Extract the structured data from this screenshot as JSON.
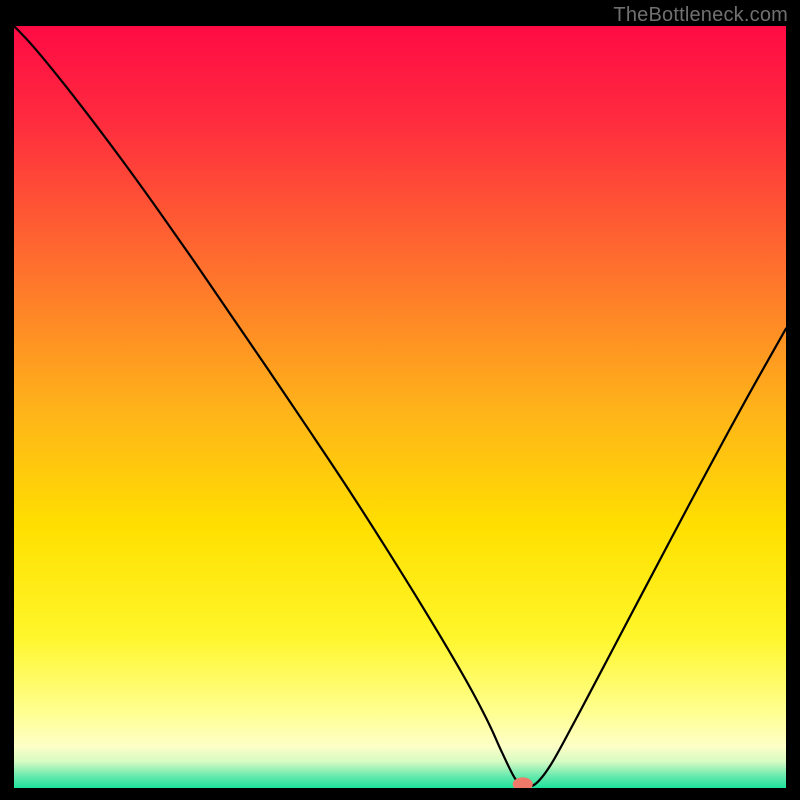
{
  "watermark": "TheBottleneck.com",
  "chart_data": {
    "type": "line",
    "title": "",
    "xlabel": "",
    "ylabel": "",
    "xlim": [
      0,
      100
    ],
    "ylim": [
      0,
      100
    ],
    "grid": false,
    "legend": false,
    "axes_visible": false,
    "background_gradient": {
      "direction": "vertical",
      "stops": [
        {
          "pos": 0.0,
          "color": "#ff0b44"
        },
        {
          "pos": 0.12,
          "color": "#ff2a3f"
        },
        {
          "pos": 0.3,
          "color": "#ff6a2f"
        },
        {
          "pos": 0.5,
          "color": "#ffb21a"
        },
        {
          "pos": 0.66,
          "color": "#ffe000"
        },
        {
          "pos": 0.8,
          "color": "#fff62a"
        },
        {
          "pos": 0.9,
          "color": "#ffff90"
        },
        {
          "pos": 0.945,
          "color": "#fdffc6"
        },
        {
          "pos": 0.965,
          "color": "#d7fbc4"
        },
        {
          "pos": 0.985,
          "color": "#64e9ad"
        },
        {
          "pos": 1.0,
          "color": "#1de39a"
        }
      ]
    },
    "series": [
      {
        "name": "bottleneck-curve",
        "color": "#000000",
        "width": 2.2,
        "x": [
          0.0,
          2.5,
          6.0,
          10.0,
          14.0,
          18.0,
          23.0,
          28.0,
          33.0,
          38.0,
          43.0,
          48.0,
          52.0,
          55.0,
          57.5,
          59.5,
          61.0,
          62.0,
          63.2,
          65.0,
          66.2,
          67.5,
          69.5,
          72.5,
          76.0,
          80.0,
          85.0,
          90.0,
          95.0,
          100.0
        ],
        "values": [
          100.0,
          97.3,
          93.0,
          87.8,
          82.4,
          76.8,
          69.6,
          62.2,
          54.8,
          47.3,
          39.7,
          31.8,
          25.3,
          20.3,
          16.0,
          12.4,
          9.5,
          7.4,
          4.7,
          1.1,
          0.5,
          0.5,
          3.0,
          8.5,
          15.2,
          22.9,
          32.5,
          42.0,
          51.3,
          60.3
        ]
      }
    ],
    "marker": {
      "name": "optimal-point",
      "x": 65.9,
      "y": 0.5,
      "color": "#f07a6a",
      "rx": 1.3,
      "ry": 0.9
    }
  }
}
